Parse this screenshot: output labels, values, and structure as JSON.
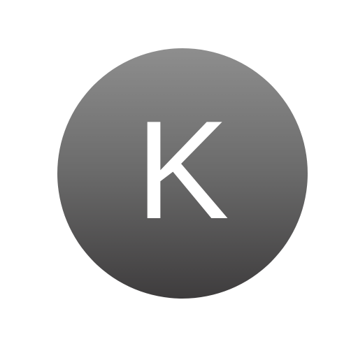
{
  "avatar": {
    "initial": "K",
    "colors": {
      "gradient_top": "#8e8e8e",
      "gradient_bottom": "#3e3c3d",
      "letter": "#ffffff",
      "background": "#ffffff"
    }
  }
}
